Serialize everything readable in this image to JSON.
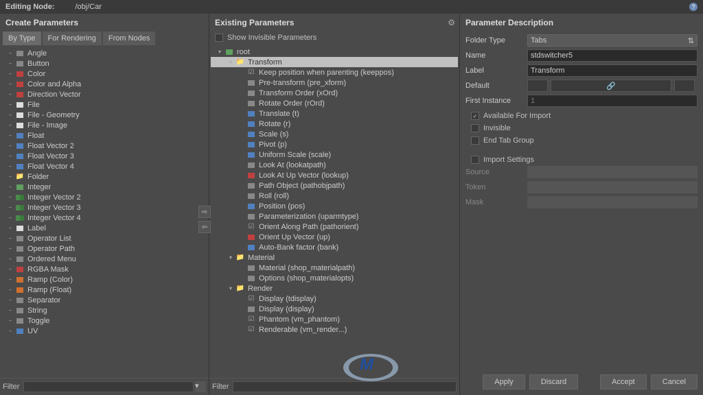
{
  "header": {
    "label": "Editing Node:",
    "path": "/obj/Car"
  },
  "left": {
    "title": "Create Parameters",
    "tabs": [
      "By Type",
      "For Rendering",
      "From Nodes"
    ],
    "items": [
      {
        "label": "Angle",
        "icon": "gray",
        "toggle": "−"
      },
      {
        "label": "Button",
        "icon": "gray",
        "toggle": "−"
      },
      {
        "label": "Color",
        "icon": "red",
        "toggle": "−"
      },
      {
        "label": "Color and Alpha",
        "icon": "red",
        "toggle": "−"
      },
      {
        "label": "Direction Vector",
        "icon": "red",
        "toggle": "−"
      },
      {
        "label": "File",
        "icon": "white",
        "toggle": "−"
      },
      {
        "label": "File - Geometry",
        "icon": "white",
        "toggle": "−"
      },
      {
        "label": "File - Image",
        "icon": "white",
        "toggle": "−"
      },
      {
        "label": "Float",
        "icon": "blue",
        "toggle": "−"
      },
      {
        "label": "Float Vector 2",
        "icon": "blue",
        "toggle": "−"
      },
      {
        "label": "Float Vector 3",
        "icon": "blue",
        "toggle": "−"
      },
      {
        "label": "Float Vector 4",
        "icon": "blue",
        "toggle": "−"
      },
      {
        "label": "Folder",
        "icon": "folder",
        "toggle": "−"
      },
      {
        "label": "Integer",
        "icon": "green",
        "toggle": "−"
      },
      {
        "label": "Integer Vector 2",
        "icon": "greenbar",
        "toggle": "−"
      },
      {
        "label": "Integer Vector 3",
        "icon": "greenbar",
        "toggle": "−"
      },
      {
        "label": "Integer Vector 4",
        "icon": "greenbar",
        "toggle": "−"
      },
      {
        "label": "Label",
        "icon": "white",
        "toggle": "−"
      },
      {
        "label": "Operator List",
        "icon": "gray",
        "toggle": "−"
      },
      {
        "label": "Operator Path",
        "icon": "gray",
        "toggle": "−"
      },
      {
        "label": "Ordered Menu",
        "icon": "gray",
        "toggle": "−"
      },
      {
        "label": "RGBA Mask",
        "icon": "red",
        "toggle": "−"
      },
      {
        "label": "Ramp (Color)",
        "icon": "orange",
        "toggle": "−"
      },
      {
        "label": "Ramp (Float)",
        "icon": "orange",
        "toggle": "−"
      },
      {
        "label": "Separator",
        "icon": "gray",
        "toggle": "−"
      },
      {
        "label": "String",
        "icon": "gray",
        "toggle": "−"
      },
      {
        "label": "Toggle",
        "icon": "gray",
        "toggle": "−"
      },
      {
        "label": "UV",
        "icon": "blue",
        "toggle": "−"
      }
    ],
    "filter_label": "Filter"
  },
  "mid": {
    "title": "Existing Parameters",
    "show_invisible": "Show Invisible Parameters",
    "items": [
      {
        "label": "root",
        "indent": 0,
        "icon": "green",
        "toggle": "▾"
      },
      {
        "label": "Transform",
        "indent": 1,
        "icon": "folder",
        "toggle": "▾",
        "selected": true
      },
      {
        "label": "Keep position when parenting (keeppos)",
        "indent": 2,
        "icon": "check"
      },
      {
        "label": "Pre-transform (pre_xform)",
        "indent": 2,
        "icon": "gray"
      },
      {
        "label": "Transform Order (xOrd)",
        "indent": 2,
        "icon": "gray"
      },
      {
        "label": "Rotate Order (rOrd)",
        "indent": 2,
        "icon": "gray"
      },
      {
        "label": "Translate (t)",
        "indent": 2,
        "icon": "blue"
      },
      {
        "label": "Rotate (r)",
        "indent": 2,
        "icon": "blue"
      },
      {
        "label": "Scale (s)",
        "indent": 2,
        "icon": "blue"
      },
      {
        "label": "Pivot (p)",
        "indent": 2,
        "icon": "blue"
      },
      {
        "label": "Uniform Scale (scale)",
        "indent": 2,
        "icon": "blue"
      },
      {
        "label": "Look At (lookatpath)",
        "indent": 2,
        "icon": "gray"
      },
      {
        "label": "Look At Up Vector (lookup)",
        "indent": 2,
        "icon": "red"
      },
      {
        "label": "Path Object (pathobjpath)",
        "indent": 2,
        "icon": "gray"
      },
      {
        "label": "Roll (roll)",
        "indent": 2,
        "icon": "gray"
      },
      {
        "label": "Position (pos)",
        "indent": 2,
        "icon": "blue"
      },
      {
        "label": "Parameterization (uparmtype)",
        "indent": 2,
        "icon": "gray"
      },
      {
        "label": "Orient Along Path (pathorient)",
        "indent": 2,
        "icon": "check"
      },
      {
        "label": "Orient Up Vector (up)",
        "indent": 2,
        "icon": "red"
      },
      {
        "label": "Auto-Bank factor (bank)",
        "indent": 2,
        "icon": "blue"
      },
      {
        "label": "Material",
        "indent": 1,
        "icon": "folder",
        "toggle": "▾"
      },
      {
        "label": "Material (shop_materialpath)",
        "indent": 2,
        "icon": "gray"
      },
      {
        "label": "Options (shop_materialopts)",
        "indent": 2,
        "icon": "gray"
      },
      {
        "label": "Render",
        "indent": 1,
        "icon": "folder",
        "toggle": "▾"
      },
      {
        "label": "Display (tdisplay)",
        "indent": 2,
        "icon": "check"
      },
      {
        "label": "Display (display)",
        "indent": 2,
        "icon": "gray"
      },
      {
        "label": "Phantom (vm_phantom)",
        "indent": 2,
        "icon": "check"
      },
      {
        "label": "Renderable (vm_render...)",
        "indent": 2,
        "icon": "check"
      }
    ],
    "filter_label": "Filter"
  },
  "right": {
    "title": "Parameter Description",
    "folder_type_label": "Folder Type",
    "folder_type_value": "Tabs",
    "name_label": "Name",
    "name_value": "stdswitcher5",
    "label_label": "Label",
    "label_value": "Transform",
    "default_label": "Default",
    "first_instance_label": "First Instance",
    "first_instance_value": "1",
    "available_import": "Available For Import",
    "invisible": "Invisible",
    "end_tab": "End Tab Group",
    "import_settings": "Import Settings",
    "source_label": "Source",
    "token_label": "Token",
    "mask_label": "Mask"
  },
  "buttons": {
    "apply": "Apply",
    "discard": "Discard",
    "accept": "Accept",
    "cancel": "Cancel"
  }
}
